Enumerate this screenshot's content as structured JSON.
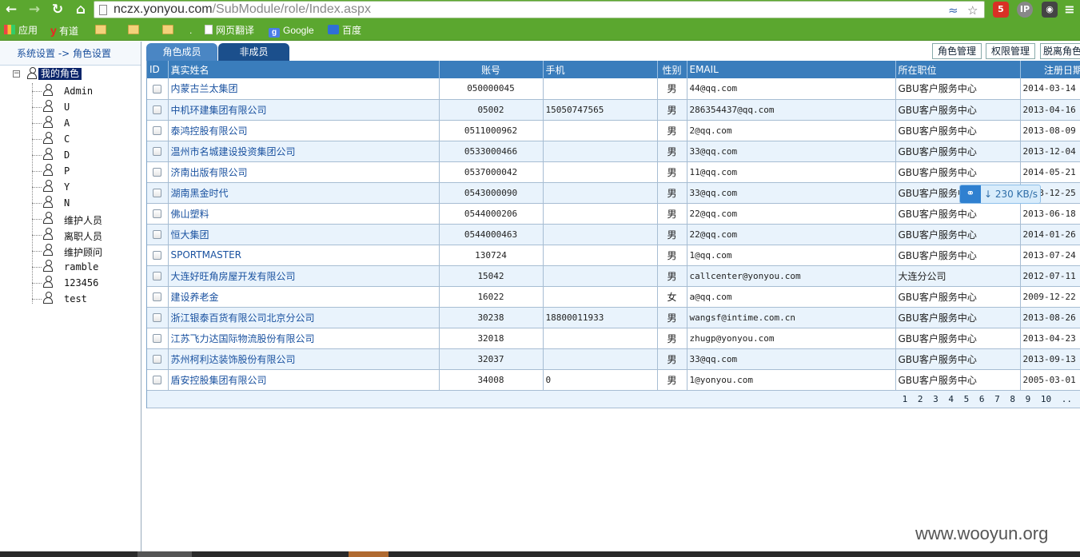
{
  "browser": {
    "url_host": "nczx.yonyou.com",
    "url_path": "/SubModule/role/Index.aspx",
    "ext_badge": "5",
    "ext_ip": "IP"
  },
  "bookmarks": [
    {
      "label": "应用",
      "icon": "apps-grid-icon"
    },
    {
      "label": "有道",
      "icon": "youdao-icon"
    },
    {
      "label": "",
      "icon": "folder-icon"
    },
    {
      "label": "",
      "icon": "folder-icon"
    },
    {
      "label": "",
      "icon": "folder-icon"
    },
    {
      "label": ".",
      "icon": ""
    },
    {
      "label": "网页翻译",
      "icon": "page-icon"
    },
    {
      "label": "Google",
      "icon": "google-icon"
    },
    {
      "label": "百度",
      "icon": "baidu-icon"
    }
  ],
  "sidebar": {
    "breadcrumb": "系统设置 -> 角色设置",
    "root": "我的角色",
    "roles": [
      "Admin",
      "U",
      "A",
      "C",
      "D",
      "P",
      "Y",
      "N",
      "维护人员",
      "离职人员",
      "维护顾问",
      "ramble",
      "123456",
      "test"
    ]
  },
  "tabs": {
    "members": "角色成员",
    "non_members": "非成员"
  },
  "toolbar": {
    "role_manage": "角色管理",
    "perm_manage": "权限管理",
    "leave_role": "脱离角色"
  },
  "grid": {
    "headers": [
      "ID",
      "真实姓名",
      "账号",
      "手机",
      "性别",
      "EMAIL",
      "所在职位",
      "注册日期"
    ],
    "rows": [
      {
        "name": "内蒙古兰太集团",
        "account": "050000045",
        "phone": "",
        "gender": "男",
        "email": "44@qq.com",
        "position": "GBU客户服务中心",
        "date": "2014-03-14"
      },
      {
        "name": "中机环建集团有限公司",
        "account": "05002",
        "phone": "15050747565",
        "gender": "男",
        "email": "286354437@qq.com",
        "position": "GBU客户服务中心",
        "date": "2013-04-16"
      },
      {
        "name": "泰鸿控股有限公司",
        "account": "0511000962",
        "phone": "",
        "gender": "男",
        "email": "2@qq.com",
        "position": "GBU客户服务中心",
        "date": "2013-08-09"
      },
      {
        "name": "温州市名城建设投资集团公司",
        "account": "0533000466",
        "phone": "",
        "gender": "男",
        "email": "33@qq.com",
        "position": "GBU客户服务中心",
        "date": "2013-12-04"
      },
      {
        "name": "济南出版有限公司",
        "account": "0537000042",
        "phone": "",
        "gender": "男",
        "email": "11@qq.com",
        "position": "GBU客户服务中心",
        "date": "2014-05-21"
      },
      {
        "name": "湖南黑金时代",
        "account": "0543000090",
        "phone": "",
        "gender": "男",
        "email": "33@qq.com",
        "position": "GBU客户服务中心",
        "date": "2013-12-25"
      },
      {
        "name": "佛山塑料",
        "account": "0544000206",
        "phone": "",
        "gender": "男",
        "email": "22@qq.com",
        "position": "GBU客户服务中心",
        "date": "2013-06-18"
      },
      {
        "name": "恒大集团",
        "account": "0544000463",
        "phone": "",
        "gender": "男",
        "email": "22@qq.com",
        "position": "GBU客户服务中心",
        "date": "2014-01-26"
      },
      {
        "name": "SPORTMASTER",
        "account": "130724",
        "phone": "",
        "gender": "男",
        "email": "1@qq.com",
        "position": "GBU客户服务中心",
        "date": "2013-07-24"
      },
      {
        "name": "大连好旺角房屋开发有限公司",
        "account": "15042",
        "phone": "",
        "gender": "男",
        "email": "callcenter@yonyou.com",
        "position": "大连分公司",
        "date": "2012-07-11"
      },
      {
        "name": "建设养老金",
        "account": "16022",
        "phone": "",
        "gender": "女",
        "email": "a@qq.com",
        "position": "GBU客户服务中心",
        "date": "2009-12-22"
      },
      {
        "name": "浙江银泰百货有限公司北京分公司",
        "account": "30238",
        "phone": "18800011933",
        "gender": "男",
        "email": "wangsf@intime.com.cn",
        "position": "GBU客户服务中心",
        "date": "2013-08-26"
      },
      {
        "name": "江苏飞力达国际物流股份有限公司",
        "account": "32018",
        "phone": "",
        "gender": "男",
        "email": "zhugp@yonyou.com",
        "position": "GBU客户服务中心",
        "date": "2013-04-23"
      },
      {
        "name": "苏州柯利达装饰股份有限公司",
        "account": "32037",
        "phone": "",
        "gender": "男",
        "email": "33@qq.com",
        "position": "GBU客户服务中心",
        "date": "2013-09-13"
      },
      {
        "name": "盾安控股集团有限公司",
        "account": "34008",
        "phone": "0",
        "gender": "男",
        "email": "1@yonyou.com",
        "position": "GBU客户服务中心",
        "date": "2005-03-01"
      }
    ],
    "pager": "1 2 3 4 5 6 7 8 9 10 .."
  },
  "overlay": {
    "speed": "230 KB/s"
  },
  "watermark": "www.wooyun.org",
  "colors": {
    "chrome_green": "#5ba72f",
    "header_blue": "#3a7dbc",
    "tab_dark": "#1b4f8c",
    "link_blue": "#1a52a0"
  }
}
